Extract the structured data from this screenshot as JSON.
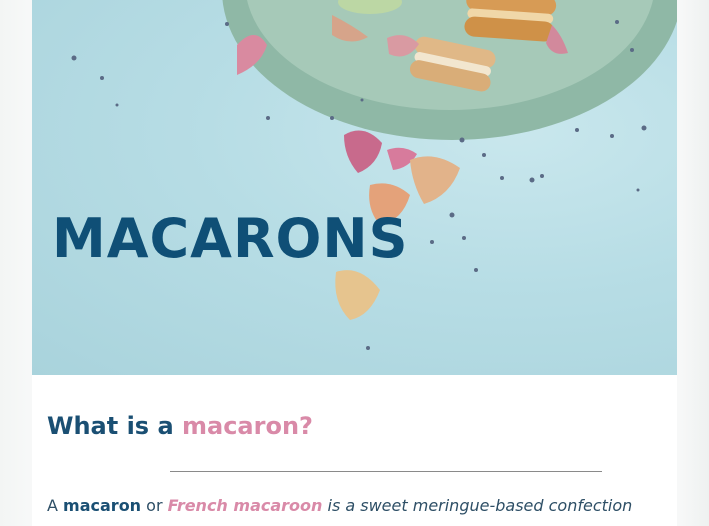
{
  "hero": {
    "title": "MACARONS",
    "image_subject": "macarons on a green plate with scattered dried petals"
  },
  "section": {
    "heading_prefix": "What is a ",
    "heading_accent": "macaron?"
  },
  "intro": {
    "word_a": "A",
    "term_macaron": "macaron",
    "word_or": "or",
    "term_french": "French macaroon",
    "tail": "is a sweet meringue-based confection"
  },
  "colors": {
    "brand_blue": "#0f4f76",
    "accent_pink": "#d98aa8",
    "hero_background": "#b7dde5"
  }
}
